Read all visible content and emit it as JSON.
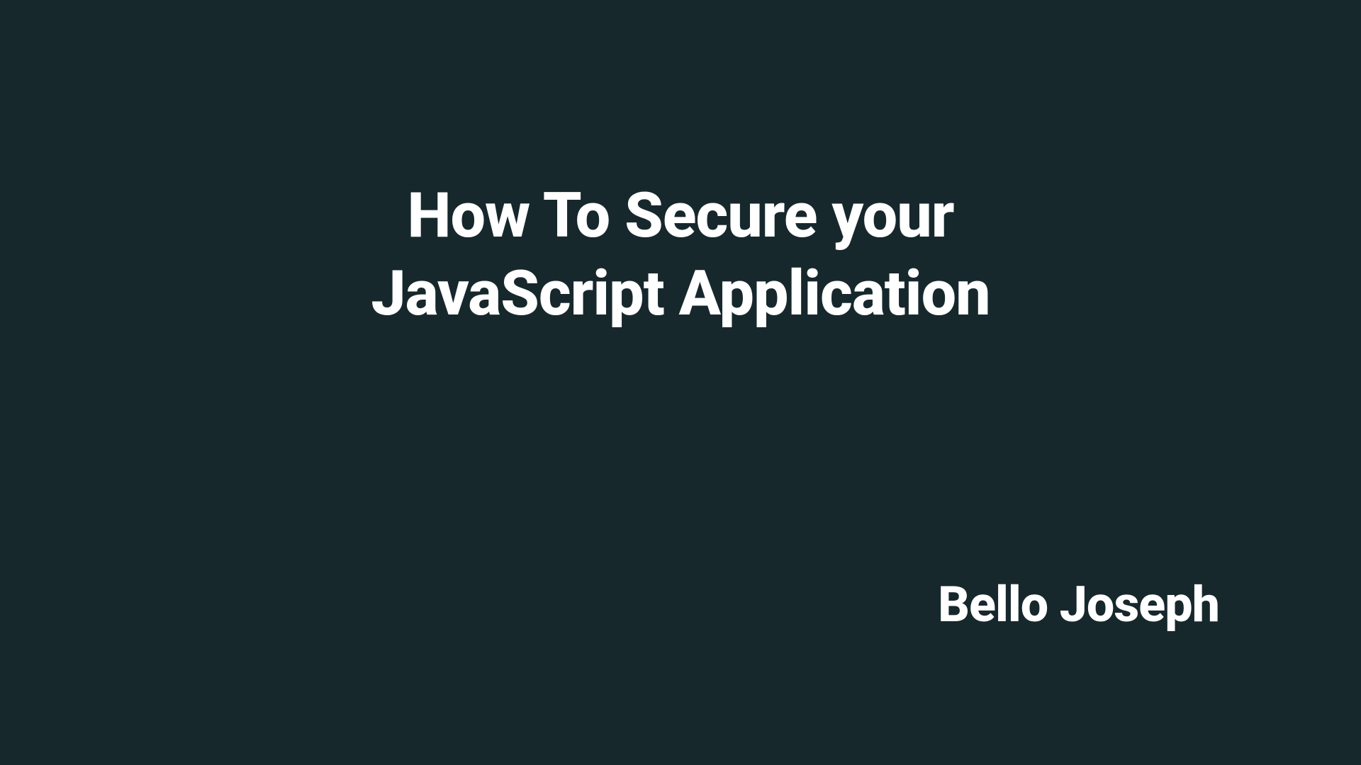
{
  "slide": {
    "title_line1": "How To Secure your",
    "title_line2": "JavaScript Application",
    "author": "Bello Joseph"
  },
  "colors": {
    "background": "#17282d",
    "text": "#ffffff"
  }
}
